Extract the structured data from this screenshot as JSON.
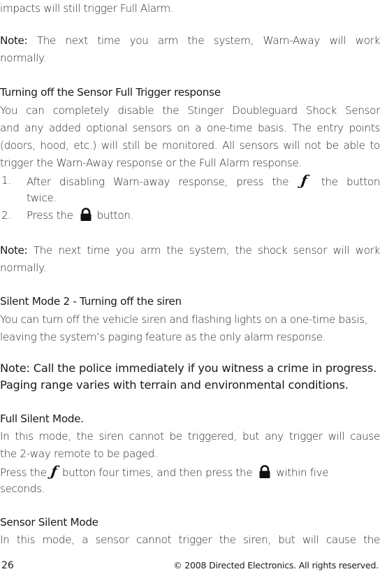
{
  "intro_tail": "impacts will still trigger Full Alarm.",
  "note1": {
    "label": "Note:",
    "text": " The next time you arm the system, Warn-Away will work",
    "text2": "normally."
  },
  "section1": {
    "heading": "Turning off the Sensor Full Trigger response",
    "lines": [
      "You can completely disable the Stinger Doubleguard Shock Sensor",
      "and any added optional sensors on a one-time basis. The entry points",
      "(doors, hood, etc.) will still be monitored. All sensors will not be able to",
      "trigger the Warn-Away response or the Full Alarm response."
    ],
    "steps": [
      {
        "num": "1.",
        "before": "After disabling Warn-away response, press the",
        "icon": "f-button-icon",
        "after": " the button",
        "cont": "twice."
      },
      {
        "num": "2.",
        "before": "Press the",
        "icon": "lock-icon",
        "after": "button."
      }
    ]
  },
  "note2": {
    "label": "Note:",
    "text": " The next time you arm the system, the shock sensor will work",
    "text2": "normally."
  },
  "section2": {
    "heading": "Silent Mode 2 - Turning off the siren",
    "lines": [
      "You can turn off the vehicle siren and flashing lights on a one-time basis,",
      "leaving the system’s paging feature as the only alarm response."
    ],
    "note_bold": [
      "Note: Call the police immediately if you witness a crime in progress.",
      "Paging range varies with terrain and environmental conditions."
    ]
  },
  "section3": {
    "heading": "Full Silent Mode.",
    "lines": [
      "In this mode, the siren cannot be triggered, but any trigger will cause",
      "the 2-way remote to be paged."
    ],
    "press_before": "Press the",
    "press_mid": "button four times, and then press the",
    "press_after": "within five",
    "press_cont": "seconds."
  },
  "section4": {
    "heading": "Sensor Silent Mode",
    "lines": [
      "In this mode, a sensor cannot trigger the siren, but will cause the"
    ]
  },
  "icons": {
    "f_glyph": "ƒ"
  },
  "footer": {
    "page_number": "26",
    "copyright": "© 2008 Directed Electronics. All rights reserved."
  }
}
